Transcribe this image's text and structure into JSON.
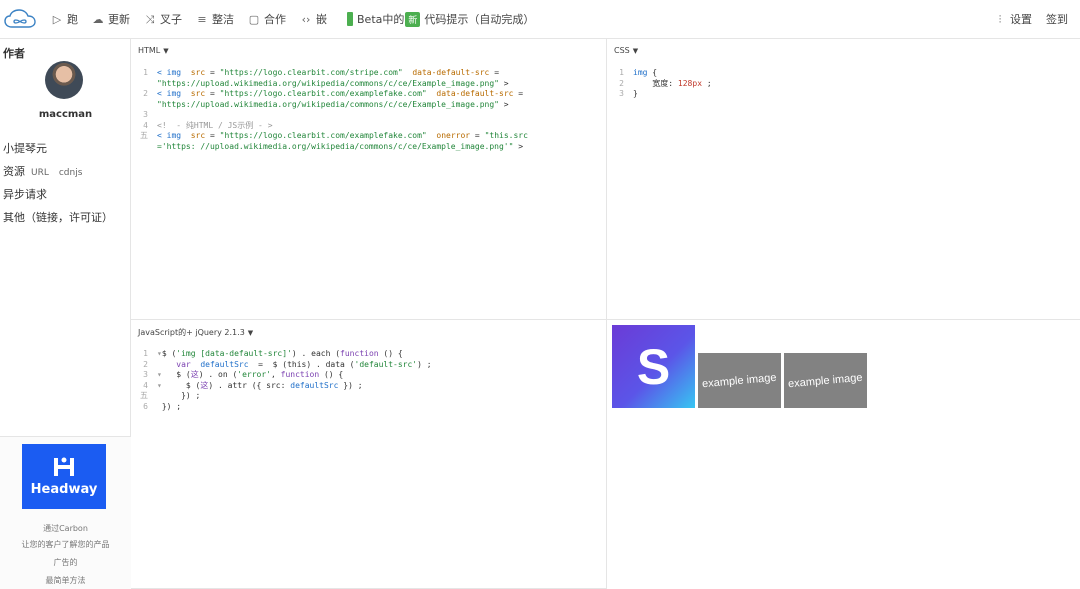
{
  "toolbar": {
    "run": "跑",
    "update": "更新",
    "fork": "叉子",
    "tidy": "整洁",
    "collaborate": "合作",
    "embed": "嵌",
    "beta_prefix": "Beta中的",
    "beta_new": "新",
    "beta_text": "代码提示（自动完成）",
    "settings": "设置",
    "signin": "签到"
  },
  "sidebar": {
    "title": "作者",
    "author": "maccman",
    "fiddle": "小提琴元",
    "resources": "资源",
    "resources_url": "URL",
    "resources_cdn": "cdnjs",
    "async": "异步请求",
    "other": "其他（链接，许可证）"
  },
  "ad": {
    "brand": "Headway",
    "line1": "通过Carbon",
    "line2": "让您的客户了解您的产品",
    "line3": "广告的",
    "line4": "最简单方法"
  },
  "panels": {
    "html_label": "HTML",
    "css_label": "CSS",
    "js_label": "JavaScript的+ jQuery 2.1.3"
  },
  "html_code": {
    "n1": "1",
    "n2": "2",
    "n3": "3",
    "n4": "4",
    "n5": "五",
    "l1a_tag": "< img",
    "l1a_attr": "src",
    "l1a_eq": " = ",
    "l1a_str": "\"https://logo.clearbit.com/stripe.com\"",
    "l1a_attr2": "data-default-src",
    "l1a_eq2": " =",
    "l1b_str": "\"https://upload.wikimedia.org/wikipedia/commons/c/ce/Example_image.png\"",
    "l1b_end": " >",
    "l2a_tag": "< img",
    "l2a_attr": "src",
    "l2a_eq": " = ",
    "l2a_str": "\"https://logo.clearbit.com/examplefake.com\"",
    "l2a_attr2": "data-default-src",
    "l2a_eq2": " =",
    "l2b_str": "\"https://upload.wikimedia.org/wikipedia/commons/c/ce/Example_image.png\"",
    "l2b_end": " >",
    "l4": "<!  - 纯HTML / JS示例 - >",
    "l5a_tag": "< img",
    "l5a_attr": "src",
    "l5a_eq": " = ",
    "l5a_str": "\"https://logo.clearbit.com/examplefake.com\"",
    "l5a_attr2": "onerror",
    "l5a_eq2": " = ",
    "l5a_str2": "\"this.src",
    "l5b_str": "='https: //upload.wikimedia.org/wikipedia/commons/c/ce/Example_image.png'\"",
    "l5b_end": " >"
  },
  "css_code": {
    "n1": "1",
    "n2": "2",
    "n3": "3",
    "l1_sel": "img",
    "l1_brace": " {",
    "l2_prop": "宽度:",
    "l2_val": "128px",
    "l2_end": " ;",
    "l3": "}"
  },
  "js_code": {
    "n1": "1",
    "n2": "2",
    "n3": "3",
    "n4": "4",
    "n5": "五",
    "n6": "6",
    "l1_a": "$ (",
    "l1_str": "'img [data-default-src]'",
    "l1_b": ") . each (",
    "l1_kw": "function",
    "l1_c": " () {",
    "l2_kw": "var",
    "l2_id": "defaultSrc",
    "l2_a": "  =  $ (this) . data (",
    "l2_str": "'default-src'",
    "l2_b": ") ;",
    "l3_a": "$ (",
    "l3_kw": "这",
    "l3_b": ") . on (",
    "l3_str": "'error'",
    "l3_c": ", ",
    "l3_kw2": "function",
    "l3_d": " () {",
    "l4_a": "$ (",
    "l4_kw": "这",
    "l4_b": ") . attr ({ src: ",
    "l4_id": "defaultSrc",
    "l4_c": " }) ;",
    "l5": "}) ;",
    "l6": "}) ;"
  },
  "output": {
    "stripe_letter": "S",
    "example1": "example image",
    "example2": "example image"
  }
}
